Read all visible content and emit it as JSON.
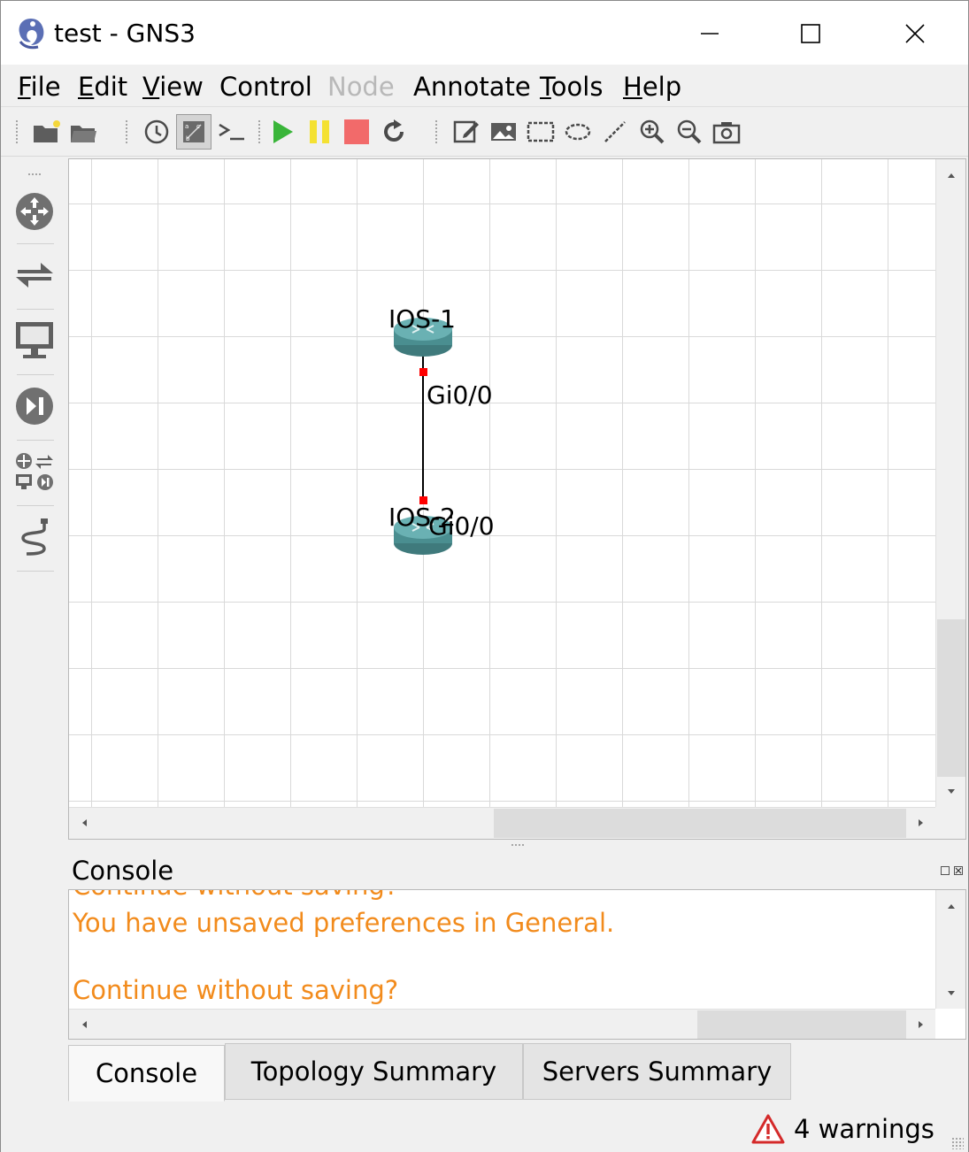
{
  "window": {
    "title": "test - GNS3",
    "controls": {
      "minimize": "minimize-icon",
      "maximize": "maximize-icon",
      "close": "close-icon"
    }
  },
  "menu": {
    "items": [
      {
        "label": "File",
        "underline": "F",
        "rest": "ile",
        "enabled": true
      },
      {
        "label": "Edit",
        "underline": "E",
        "rest": "dit",
        "enabled": true
      },
      {
        "label": "View",
        "underline": "V",
        "rest": "iew",
        "enabled": true
      },
      {
        "label": "Control",
        "underline": "",
        "rest": "Control",
        "enabled": true
      },
      {
        "label": "Node",
        "underline": "",
        "rest": "Node",
        "enabled": false
      },
      {
        "label": "Annotate",
        "underline": "",
        "rest": "Annotate",
        "enabled": true
      },
      {
        "label": "Tools",
        "underline": "T",
        "rest": "ools",
        "enabled": true
      },
      {
        "label": "Help",
        "underline": "H",
        "rest": "elp",
        "enabled": true
      }
    ]
  },
  "toolbar": {
    "buttons": [
      "new-project-icon",
      "open-project-icon",
      "snapshot-clock-icon",
      "show-interface-labels-icon",
      "console-all-icon",
      "start-all-icon",
      "suspend-all-icon",
      "stop-all-icon",
      "reload-all-icon",
      "add-note-icon",
      "insert-picture-icon",
      "draw-rectangle-icon",
      "draw-ellipse-icon",
      "draw-line-icon",
      "zoom-in-icon",
      "zoom-out-icon",
      "screenshot-icon"
    ],
    "pressed": "show-interface-labels-icon"
  },
  "left_dock": {
    "buttons": [
      "routers-icon",
      "switches-icon",
      "end-devices-icon",
      "security-devices-icon",
      "all-devices-icon",
      "add-link-icon"
    ]
  },
  "topology": {
    "nodes": [
      {
        "name": "IOS-1",
        "icon": "router-icon"
      },
      {
        "name": "IOS-2",
        "icon": "router-icon"
      }
    ],
    "link": {
      "a_interface": "Gi0/0",
      "b_interface": "Gi0/0",
      "endpoint_color": "#ff0000"
    }
  },
  "console": {
    "title": "Console",
    "lines": [
      "Continue without saving?",
      "You have unsaved preferences in General.",
      "",
      "Continue without saving?"
    ],
    "text_color": "#f28b1c"
  },
  "tabs": [
    {
      "label": "Console",
      "active": true
    },
    {
      "label": "Topology Summary",
      "active": false
    },
    {
      "label": "Servers Summary",
      "active": false
    }
  ],
  "status": {
    "warnings": "4 warnings"
  }
}
